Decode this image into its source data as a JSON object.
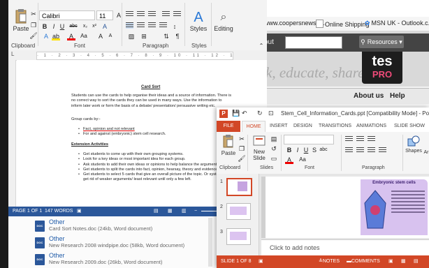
{
  "browser": {
    "url_text": "www.coopersnews.c...",
    "bookmarks": [
      "Online Shipping",
      "MSN UK - Outlook.c..."
    ],
    "search_label": "out",
    "resources_button": "Resources",
    "tagline": "k, educate, share",
    "logo_line1": "tes",
    "logo_line2": "PRO",
    "nav": [
      "About us",
      "Help"
    ]
  },
  "word": {
    "font_name": "Calibri",
    "font_size": "11",
    "groups": [
      "Clipboard",
      "Font",
      "Paragraph",
      "Styles",
      "Editing"
    ],
    "paste_label": "Paste",
    "styles_label": "Styles",
    "editing_label": "Editing",
    "doc": {
      "title": "Card Sort",
      "intro": "Students can use the cards to help organise their ideas and a source of information.  There is no correct way to sort the cards they can be used in many ways. Use the information to inform later work or form the basis of a debate/ presentation/ persuasive writing etc.",
      "group_heading": "Group cards by:-",
      "group_bullets": [
        "Fact, opinion and not relevant",
        "For and against (embryonic) stem cell research."
      ],
      "ext_heading": "Extension Activities",
      "ext_bullets": [
        "Get students to come up with their own grouping systems.",
        "Look for a key ideas or most important idea for each group.",
        "Ask students to add their own ideas or opinions to help balance the arguments.",
        "Get students to split the cards into fact, opinion, hearsay, theory and evidence.",
        "Get students to select 5 cards that give an overall picture of the topic. Or systematically get rid of weaker arguments/ least relevant until only a few left."
      ]
    },
    "status": {
      "page": "PAGE 1 OF 1",
      "words": "147 WORDS"
    },
    "results": [
      {
        "title": "Other",
        "sub": "Card Sort Notes.doc (24kb, Word document)"
      },
      {
        "title": "Other",
        "sub": "New Research 2008 windpipe.doc (58kb, Word document)"
      },
      {
        "title": "Other",
        "sub": "New Research 2009.doc (26kb, Word document)"
      }
    ]
  },
  "ppt": {
    "title": "Stem_Cell_Information_Cards.ppt [Compatibility Mode] - Pow",
    "tabs": [
      "FILE",
      "HOME",
      "INSERT",
      "DESIGN",
      "TRANSITIONS",
      "ANIMATIONS",
      "SLIDE SHOW"
    ],
    "groups": [
      "Clipboard",
      "Slides",
      "Font",
      "Paragraph"
    ],
    "paste_label": "Paste",
    "new_slide_label": "New Slide",
    "shapes_label": "Shapes",
    "arrange_label": "Ar",
    "slide_heading": "Embryonic stem cells",
    "thumb_numbers": [
      "1",
      "2",
      "3"
    ],
    "notes_placeholder": "Click to add notes",
    "status": {
      "slide": "SLIDE 1 OF 8",
      "notes": "NOTES",
      "comments": "COMMENTS"
    },
    "colors": {
      "accent": "#d24726"
    }
  },
  "colors": {
    "word_blue": "#2b579a",
    "ppt_orange": "#d24726"
  }
}
